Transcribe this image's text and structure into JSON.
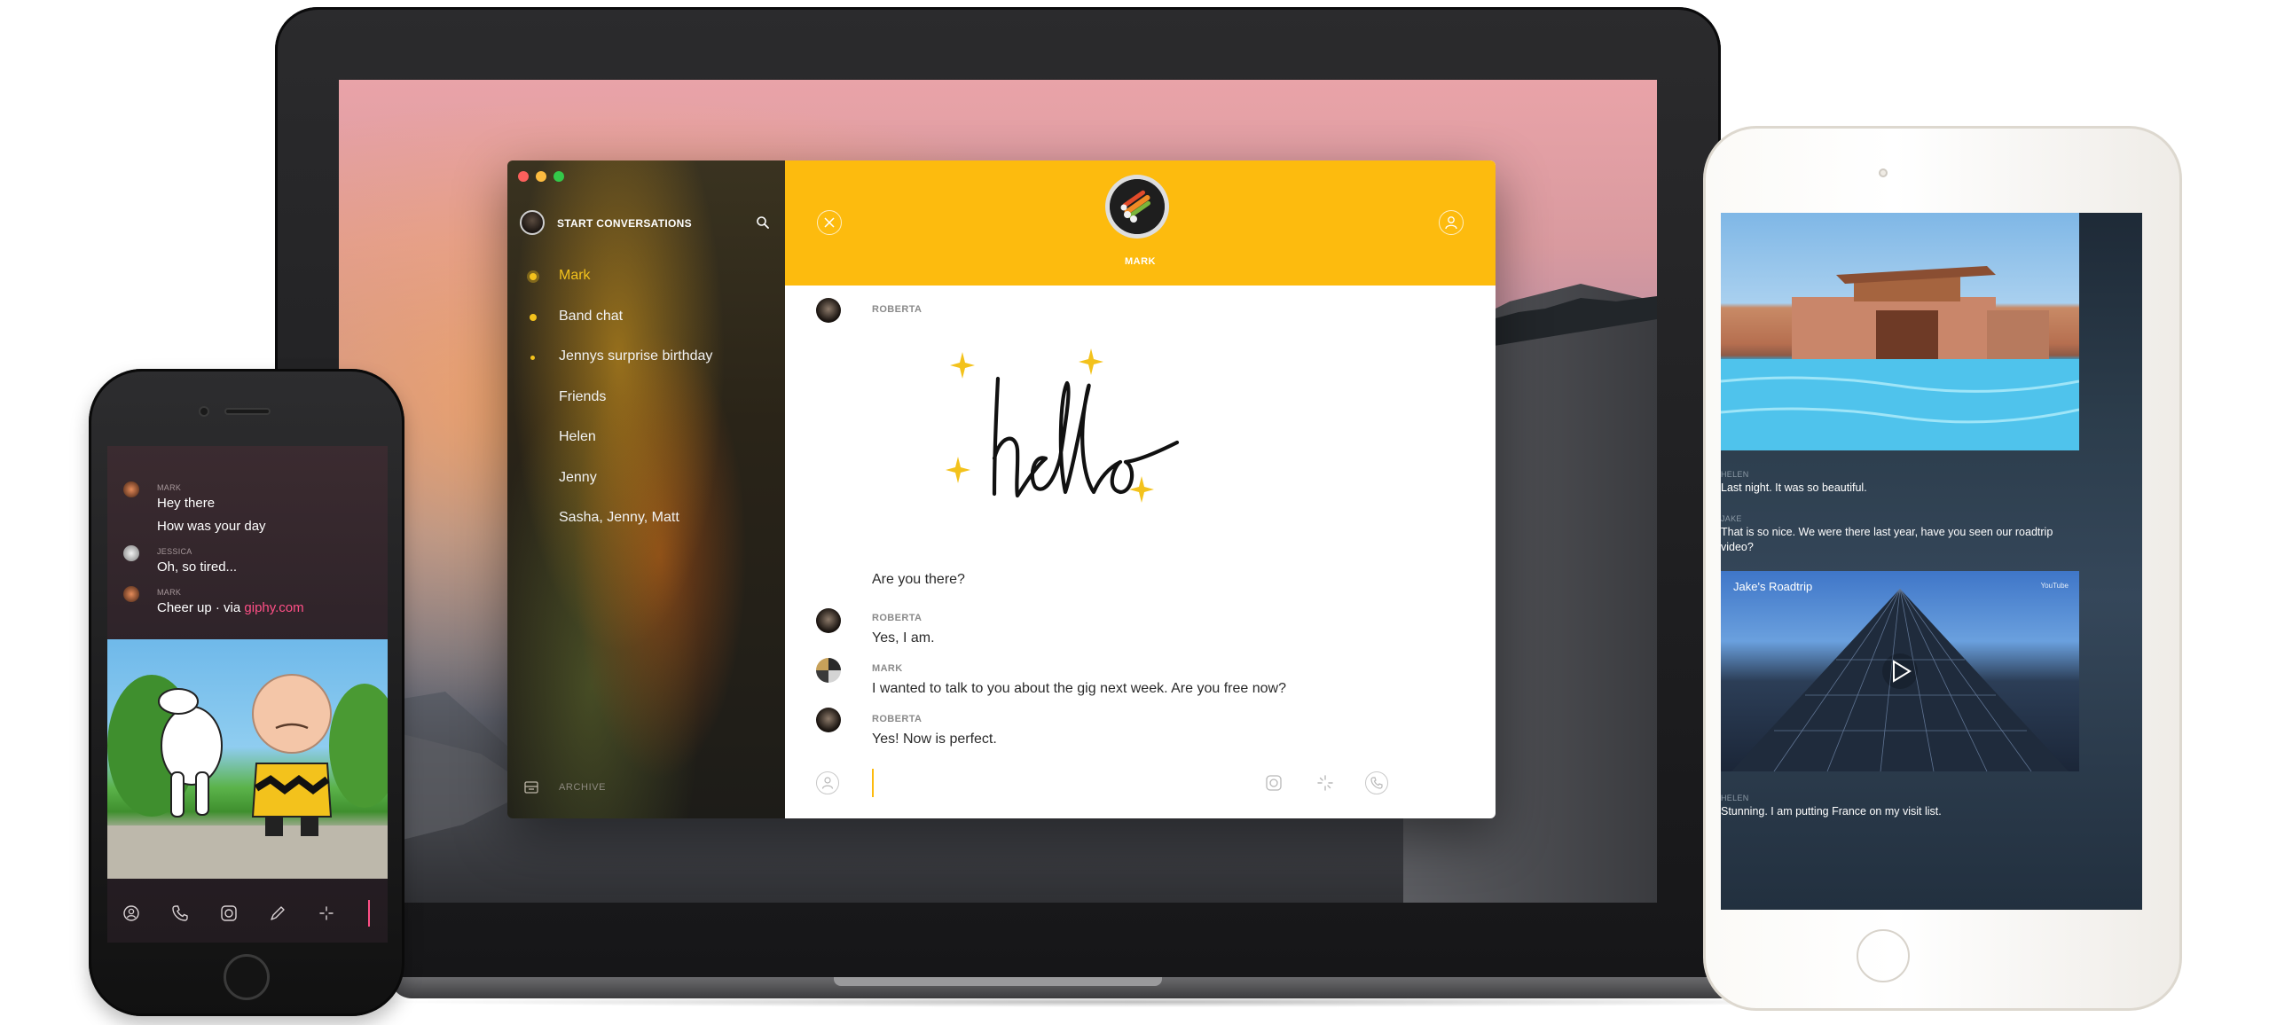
{
  "desktop": {
    "sidebar": {
      "title": "START CONVERSATIONS",
      "conversations": [
        {
          "label": "Mark",
          "state": "active"
        },
        {
          "label": "Band chat",
          "state": "unread"
        },
        {
          "label": "Jennys surprise birthday",
          "state": "unread-small"
        },
        {
          "label": "Friends",
          "state": "read"
        },
        {
          "label": "Helen",
          "state": "read"
        },
        {
          "label": "Jenny",
          "state": "read"
        },
        {
          "label": "Sasha, Jenny, Matt",
          "state": "read"
        }
      ],
      "archive_label": "ARCHIVE"
    },
    "chat": {
      "contact_name": "MARK",
      "messages": [
        {
          "author": "ROBERTA",
          "text": "",
          "sketch": "hello"
        },
        {
          "author": "",
          "text": "Are you there?"
        },
        {
          "author": "ROBERTA",
          "text": "Yes, I am."
        },
        {
          "author": "MARK",
          "text": "I wanted to talk to you about the gig next week. Are you free now?"
        },
        {
          "author": "ROBERTA",
          "text": "Yes! Now is perfect."
        }
      ]
    },
    "colors": {
      "accent": "#fdbb0e",
      "sidebar_active": "#f3c21c"
    }
  },
  "phone": {
    "messages": [
      {
        "author": "MARK",
        "lines": [
          "Hey there",
          "How was your day"
        ]
      },
      {
        "author": "JESSICA",
        "lines": [
          "Oh, so tired..."
        ]
      },
      {
        "author": "MARK",
        "text_prefix": "Cheer up · via ",
        "link": "giphy.com"
      }
    ],
    "toolbar_icons": [
      "contacts-icon",
      "phone-icon",
      "camera-icon",
      "pencil-icon",
      "sparkle-icon"
    ],
    "colors": {
      "link": "#ff4f86"
    }
  },
  "tablet": {
    "messages": [
      {
        "author": "HELEN",
        "text": "Last night. It was so beautiful."
      },
      {
        "author": "JAKE",
        "text": "That is so nice. We were there last year, have you seen our roadtrip video?"
      },
      {
        "author": "HELEN",
        "text": "Stunning. I am putting France on my visit list."
      }
    ],
    "video": {
      "title": "Jake's Roadtrip",
      "badge": "YouTube"
    }
  }
}
